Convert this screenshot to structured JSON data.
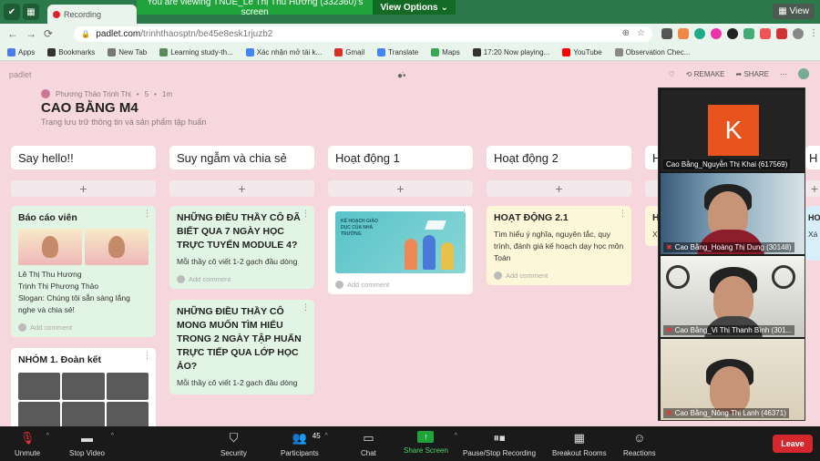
{
  "zoom_banner": {
    "message": "You are viewing TNUE_Lê Thị Thu Hương (332360)'s screen",
    "view_options": "View Options",
    "view_button": "View"
  },
  "browser": {
    "tab_title": "Recording",
    "url_host": "padlet.com",
    "url_path": "/trinhthaosptn/be45e8esk1rjuzb2",
    "bookmarks": [
      {
        "label": "Apps",
        "icon": "apps-icon",
        "color": "#4a7de8"
      },
      {
        "label": "Bookmarks",
        "icon": "star-icon",
        "color": "#333333"
      },
      {
        "label": "New Tab",
        "icon": "search-icon",
        "color": "#777777"
      },
      {
        "label": "Learning study-th...",
        "icon": "page-icon",
        "color": "#5a8a5a"
      },
      {
        "label": "Xác nhận mở tài k...",
        "icon": "google-icon",
        "color": "#4285f4"
      },
      {
        "label": "Gmail",
        "icon": "gmail-icon",
        "color": "#d93025"
      },
      {
        "label": "Translate",
        "icon": "translate-icon",
        "color": "#4285f4"
      },
      {
        "label": "Maps",
        "icon": "maps-icon",
        "color": "#34a853"
      },
      {
        "label": "17:20 Now playing...",
        "icon": "music-icon",
        "color": "#333333"
      },
      {
        "label": "YouTube",
        "icon": "youtube-icon",
        "color": "#ff0000"
      },
      {
        "label": "Observation Chec...",
        "icon": "document-icon",
        "color": "#888888"
      }
    ]
  },
  "padlet": {
    "logo": "padlet",
    "remake": "REMAKE",
    "share": "SHARE",
    "author": "Phương Thảo Trịnh Thị",
    "author_likes": "5",
    "author_time": "1m",
    "title": "CAO BẰNG M4",
    "subtitle": "Trang lưu trữ thông tin và sản phẩm tập huấn",
    "add_comment": "Add comment",
    "columns": [
      {
        "header": "Say hello!!",
        "cards": [
          {
            "title": "Báo cáo viên",
            "body": "Lê Thị Thu Hương\nTrịnh Thị Phương Thảo\nSlogan: Chúng tôi sẵn sàng lắng nghe và chia sẻ!"
          },
          {
            "title": "NHÓM 1. Đoàn kết",
            "body": ""
          }
        ]
      },
      {
        "header": "Suy ngẫm và chia sẻ",
        "cards": [
          {
            "title": "NHỮNG ĐIỀU THẦY CÔ ĐÃ BIẾT QUA 7 NGÀY HỌC TRỰC TUYẾN MODULE 4?",
            "body": "Mỗi thầy cô viết 1-2 gạch đầu dòng"
          },
          {
            "title": "NHỮNG ĐIỀU THẦY CÔ MONG MUỐN TÌM HIỂU TRONG 2 NGÀY TẬP HUẤN TRỰC TIẾP QUA LỚP HỌC ẢO?",
            "body": "Mỗi thầy cô viết 1-2 gạch đầu dòng"
          }
        ]
      },
      {
        "header": "Hoạt động 1",
        "cards": [
          {
            "title": "",
            "body": "",
            "image_caption": "KẾ HOẠCH GIÁO DỤC CỦA NHÀ TRƯỜNG"
          }
        ]
      },
      {
        "header": "Hoạt động 2",
        "cards": [
          {
            "title": "HOẠT ĐỘNG 2.1",
            "body": "Tìm hiểu ý nghĩa, nguyên tắc, quy trình, đánh giá kế hoạch dạy học môn Toán"
          }
        ]
      },
      {
        "header": "H",
        "cards": [
          {
            "title": "H",
            "body": "Xâ"
          }
        ]
      }
    ]
  },
  "video_panel": {
    "participants": [
      {
        "name": "Cao Bằng_Nguyễn Thị Khai (617569)",
        "avatar_letter": "K",
        "muted": false
      },
      {
        "name": "Cao Bằng_Hoàng Thị Dung (30148)",
        "muted": true
      },
      {
        "name": "Cao Bằng_Vi Thị Thanh Bình (301...",
        "muted": true
      },
      {
        "name": "Cao Bằng_Nông Thị Lanh (46371)",
        "muted": true
      }
    ]
  },
  "toolbar": {
    "unmute": "Unmute",
    "stop_video": "Stop Video",
    "security": "Security",
    "participants": "Participants",
    "participants_count": "45",
    "chat": "Chat",
    "share_screen": "Share Screen",
    "recording": "Pause/Stop Recording",
    "breakout": "Breakout Rooms",
    "reactions": "Reactions",
    "leave": "Leave"
  }
}
